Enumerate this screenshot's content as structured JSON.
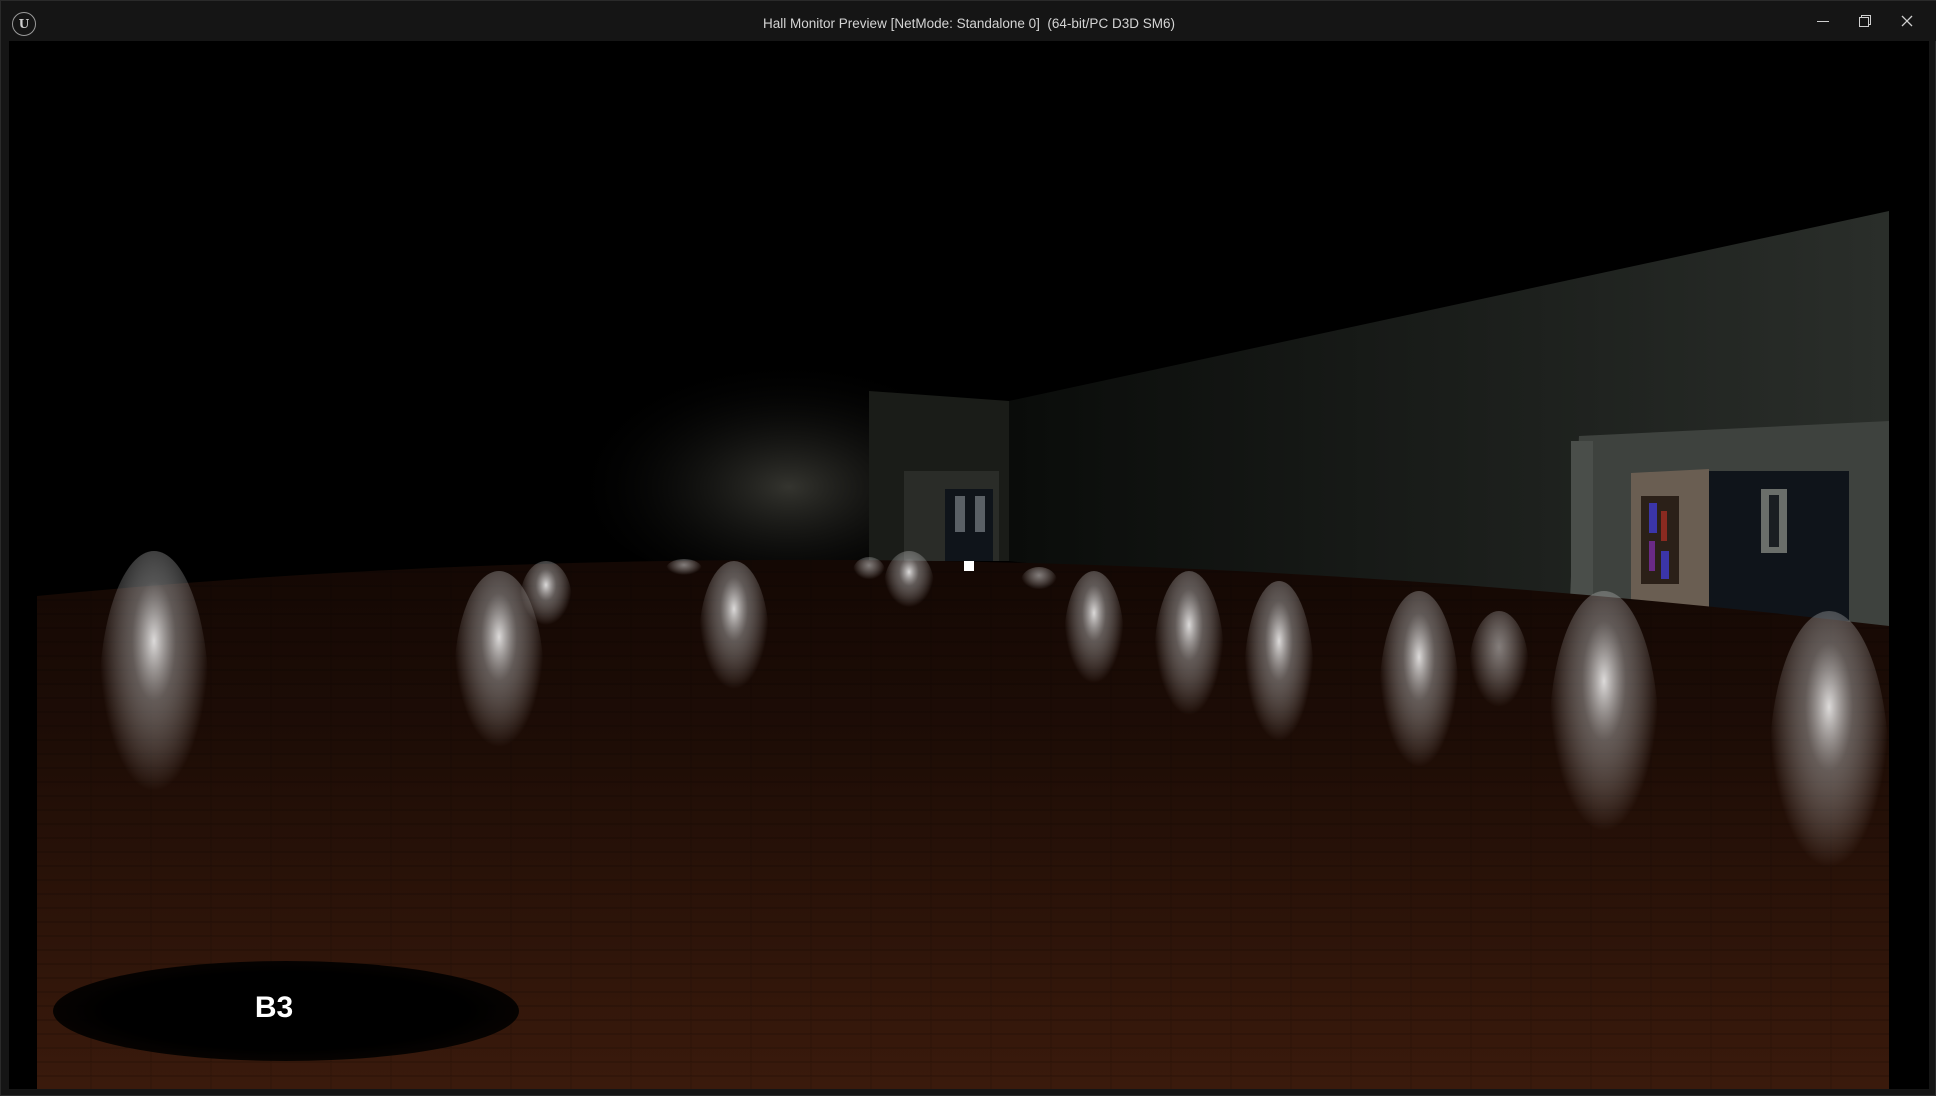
{
  "window": {
    "title": "Hall Monitor Preview [NetMode: Standalone 0]  (64-bit/PC D3D SM6)",
    "app_icon_text": "U",
    "controls": {
      "minimize_icon": "minimize-icon",
      "maximize_icon": "restore-icon",
      "close_icon": "close-icon"
    }
  },
  "hud": {
    "floor_label": "B3",
    "crosshair": "square-dot"
  },
  "colors": {
    "titlebar_bg": "#151515",
    "title_text": "#d4d4d4",
    "floor_wood": "#2a1208",
    "hud_text": "#ffffff"
  }
}
